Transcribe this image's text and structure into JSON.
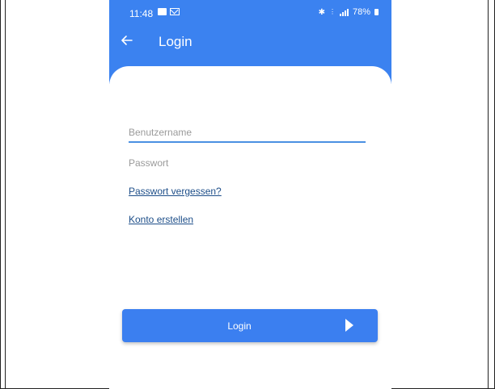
{
  "status_bar": {
    "time": "11:48",
    "battery": "78%",
    "icons": [
      "image-icon",
      "mail-icon",
      "bluetooth-icon",
      "network-icon",
      "signal-icon",
      "battery-icon"
    ]
  },
  "app_bar": {
    "title": "Login",
    "color": "#3b82f0"
  },
  "form": {
    "username_placeholder": "Benutzername",
    "password_placeholder": "Passwort",
    "forgot_password": "Passwort vergessen?",
    "create_account": "Konto erstellen",
    "login_button": "Login"
  }
}
